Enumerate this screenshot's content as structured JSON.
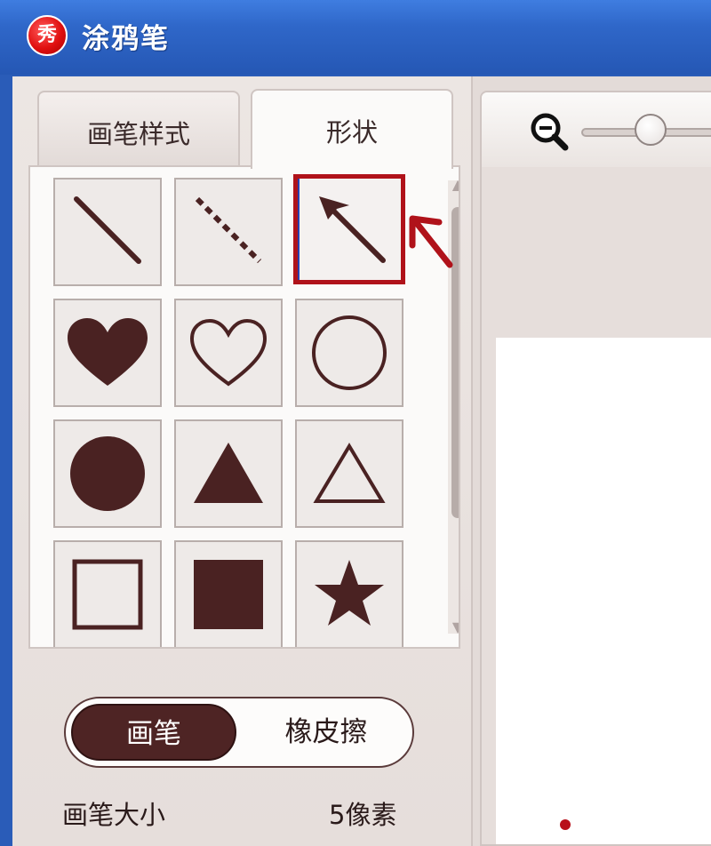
{
  "window": {
    "title": "涂鸦笔",
    "logo_glyph": "秀",
    "logo_color": "#e01010"
  },
  "tabs": [
    {
      "label": "画笔样式",
      "active": false
    },
    {
      "label": "形状",
      "active": true
    }
  ],
  "shapes": [
    {
      "icon": "line-icon",
      "selected": false
    },
    {
      "icon": "dashed-line-icon",
      "selected": false
    },
    {
      "icon": "arrow-icon",
      "selected": true
    },
    {
      "icon": "heart-filled-icon",
      "selected": false
    },
    {
      "icon": "heart-outline-icon",
      "selected": false
    },
    {
      "icon": "circle-outline-icon",
      "selected": false
    },
    {
      "icon": "circle-filled-icon",
      "selected": false
    },
    {
      "icon": "triangle-filled-icon",
      "selected": false
    },
    {
      "icon": "triangle-outline-icon",
      "selected": false
    },
    {
      "icon": "square-outline-icon",
      "selected": false
    },
    {
      "icon": "square-filled-icon",
      "selected": false
    },
    {
      "icon": "star-filled-icon",
      "selected": false
    }
  ],
  "mode_toggle": {
    "brush_label": "画笔",
    "eraser_label": "橡皮擦",
    "active": "brush"
  },
  "brush_size": {
    "label": "画笔大小",
    "value": "5像素"
  },
  "colors": {
    "titlebar": "#2f67c9",
    "shape_ink": "#4a2222",
    "selection": "#b0121a",
    "accent_dark": "#4e2424"
  }
}
